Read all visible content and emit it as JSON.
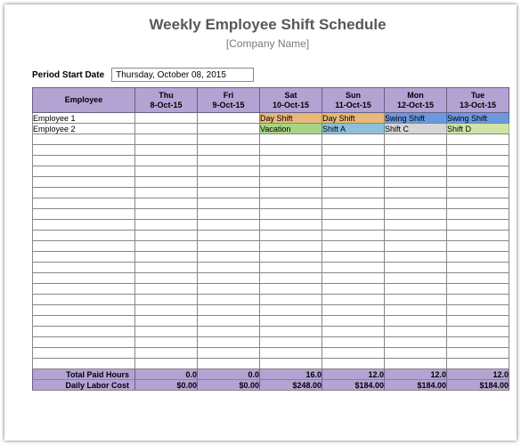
{
  "header": {
    "title": "Weekly Employee Shift Schedule",
    "subtitle": "[Company Name]"
  },
  "period": {
    "label": "Period Start Date",
    "value": "Thursday, October 08, 2015"
  },
  "columns": {
    "employee": "Employee",
    "days": [
      {
        "dow": "Thu",
        "date": "8-Oct-15"
      },
      {
        "dow": "Fri",
        "date": "9-Oct-15"
      },
      {
        "dow": "Sat",
        "date": "10-Oct-15"
      },
      {
        "dow": "Sun",
        "date": "11-Oct-15"
      },
      {
        "dow": "Mon",
        "date": "12-Oct-15"
      },
      {
        "dow": "Tue",
        "date": "13-Oct-15"
      }
    ]
  },
  "rows": [
    {
      "name": "Employee 1",
      "cells": [
        "",
        "",
        "Day Shift",
        "Day Shift",
        "Swing Shift",
        "Swing Shift"
      ],
      "styles": [
        "",
        "",
        "shift-day",
        "shift-day",
        "shift-swing",
        "shift-swing2"
      ]
    },
    {
      "name": "Employee 2",
      "cells": [
        "",
        "",
        "Vacation",
        "Shift A",
        "Shift C",
        "Shift D"
      ],
      "styles": [
        "",
        "",
        "shift-vac",
        "shift-a",
        "shift-c",
        "shift-d"
      ]
    }
  ],
  "blank_rows": 22,
  "footer": {
    "total_paid_label": "Total Paid Hours",
    "total_paid": [
      "0.0",
      "0.0",
      "16.0",
      "12.0",
      "12.0",
      "12.0"
    ],
    "daily_cost_label": "Daily Labor Cost",
    "daily_cost": [
      "$0.00",
      "$0.00",
      "$248.00",
      "$184.00",
      "$184.00",
      "$184.00"
    ]
  }
}
